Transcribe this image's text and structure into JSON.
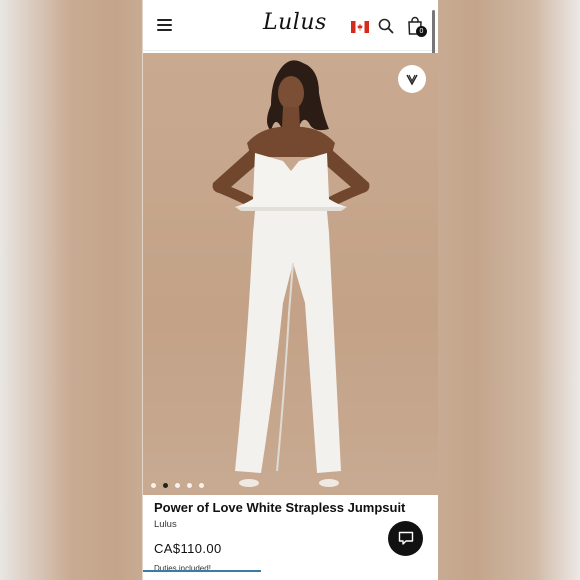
{
  "header": {
    "logo_text": "Lulus",
    "flag": "canada-flag-icon",
    "bag_count": "0"
  },
  "product": {
    "title": "Power of Love White Strapless Jumpsuit",
    "brand": "Lulus",
    "price": "CA$110.00",
    "duties_note": "Duties included!"
  },
  "gallery": {
    "total_images": 5,
    "active_index": 1
  },
  "colors": {
    "hero_background": "#c4a58b",
    "garment": "#f3f1ee",
    "chat_button": "#111111"
  },
  "icons": [
    "menu-icon",
    "canada-flag-icon",
    "search-icon",
    "shopping-bag-icon",
    "heart-icon",
    "chat-icon"
  ]
}
